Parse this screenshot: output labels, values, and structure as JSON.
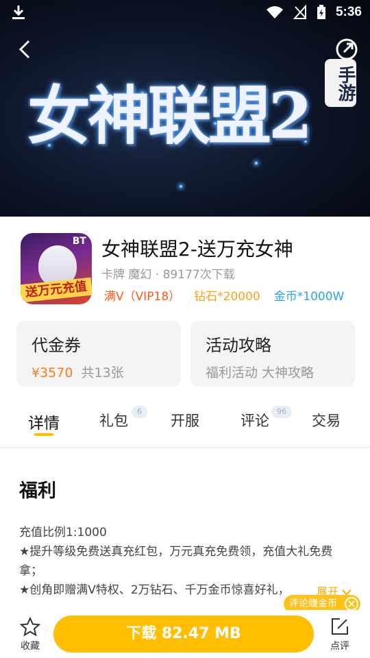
{
  "status_bar": {
    "time": "5:36"
  },
  "banner": {
    "title": "女神联盟2",
    "badge": "手游"
  },
  "app": {
    "name": "女神联盟2-送万充女神",
    "meta": "卡牌 魔幻 · 89177次下载",
    "icon_text": {
      "corner": "BT",
      "ribbon": "送万元充值"
    },
    "tags": [
      {
        "label": "满V（VIP18）",
        "color": "#ff5a1a"
      },
      {
        "label": "钻石*20000",
        "color": "#ff9f1a"
      },
      {
        "label": "金币*1000W",
        "color": "#2aa3e8"
      }
    ]
  },
  "cards": [
    {
      "title": "代金券",
      "price": "¥3570",
      "sub": "共13张"
    },
    {
      "title": "活动攻略",
      "sub": "福利活动  大神攻略"
    }
  ],
  "tabs": [
    {
      "label": "详情",
      "active": true
    },
    {
      "label": "礼包",
      "badge": "6"
    },
    {
      "label": "开服"
    },
    {
      "label": "评论",
      "badge": "96"
    },
    {
      "label": "交易"
    }
  ],
  "content": {
    "title": "福利",
    "body": "充值比例1:1000\n★提升等级免费送真充红包，万元真充免费领，充值大礼免费拿；\n★创角即赠满V特权、2万钻石、千万金币惊喜好礼，",
    "expand": "展开",
    "review_tag": "评论赚金币"
  },
  "bottom_bar": {
    "favorite": "收藏",
    "download": "下载 82.47 MB",
    "review": "点评"
  },
  "colors": {
    "accent": "#ffbe00"
  }
}
